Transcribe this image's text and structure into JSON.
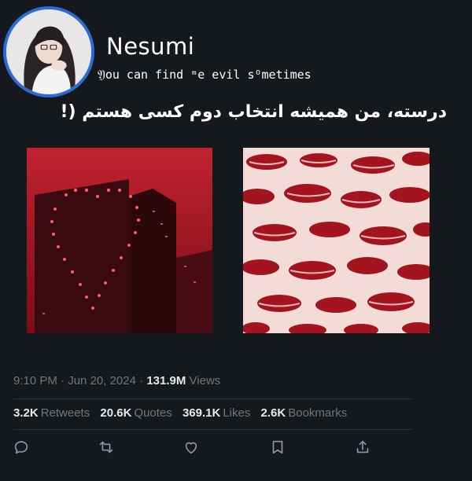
{
  "profile": {
    "display_name": "Nesumi",
    "bio": "𝔜ou can find ᵐe evil sᴼmetimes"
  },
  "tweet": {
    "text": "درسته، من همیشه انتخاب دوم کسی هستم (!"
  },
  "media": [
    {
      "description_icon": "red-heart-building-image"
    },
    {
      "description_icon": "red-lips-pattern-image"
    }
  ],
  "meta": {
    "time": "9:10 PM",
    "date": "Jun 20, 2024",
    "separator": "·",
    "views_count": "131.9M",
    "views_label": "Views"
  },
  "stats": {
    "retweets": {
      "count": "3.2K",
      "label": "Retweets"
    },
    "quotes": {
      "count": "20.6K",
      "label": "Quotes"
    },
    "likes": {
      "count": "369.1K",
      "label": "Likes"
    },
    "bookmarks": {
      "count": "2.6K",
      "label": "Bookmarks"
    }
  },
  "actions": [
    "reply-icon",
    "retweet-icon",
    "like-icon",
    "bookmark-icon",
    "share-icon"
  ],
  "colors": {
    "background": "#15181c",
    "text": "#e7e9ea",
    "muted": "#71767b",
    "avatar_ring": "#2a6bd6"
  }
}
